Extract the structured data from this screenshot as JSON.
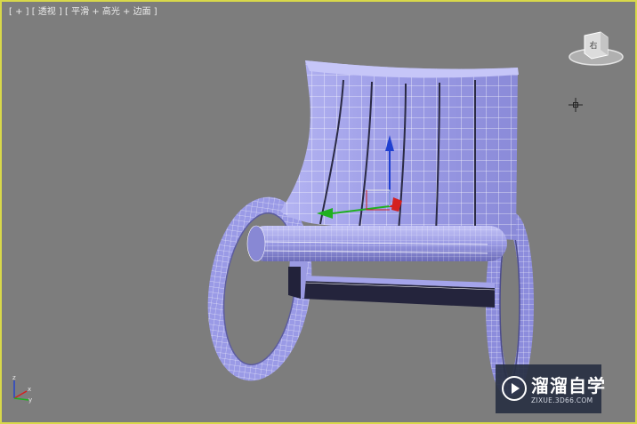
{
  "viewport": {
    "label": "[ + ] [ 透视 ] [ 平滑 + 高光 + 边面 ]",
    "frame_color": "#d8d84a",
    "background": "#7d7d7d"
  },
  "navcube": {
    "face_label": "右"
  },
  "axis_tripod": {
    "x_label": "x",
    "y_label": "y",
    "z_label": "z"
  },
  "model": {
    "mesh_color": "#a0a0ee",
    "wire_color": "#ffffff"
  },
  "gizmo": {
    "x_color": "#d42020",
    "y_color": "#20b020",
    "z_color": "#2040d0"
  },
  "watermark": {
    "title": "溜溜自学",
    "url": "ZIXUE.3D66.COM"
  }
}
